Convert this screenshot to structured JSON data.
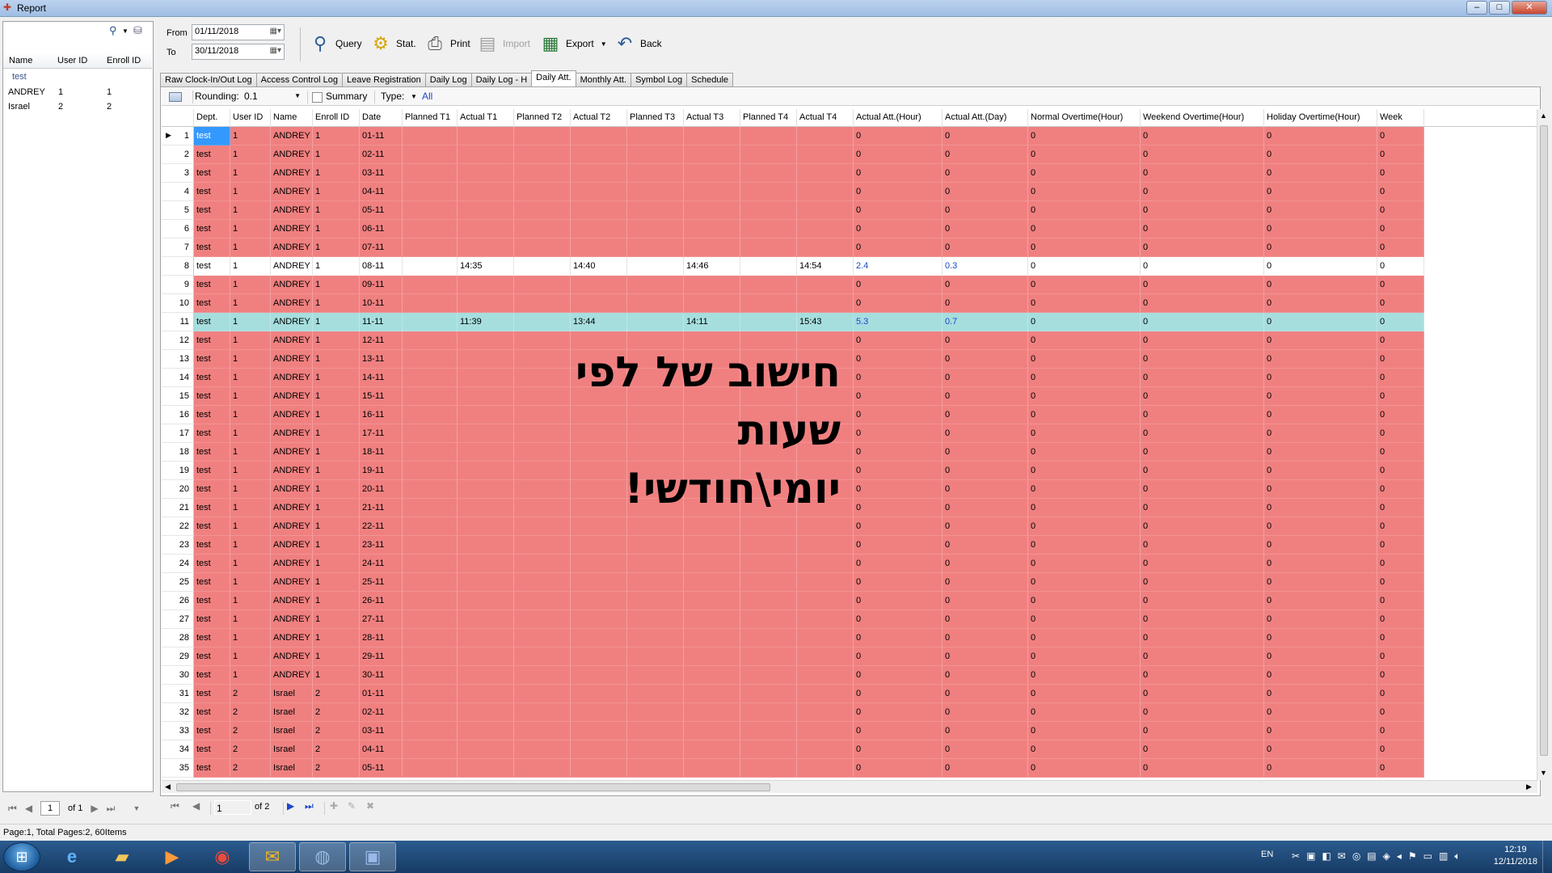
{
  "window": {
    "title": "Report",
    "min": "–",
    "max": "□",
    "close": "✕"
  },
  "left_panel": {
    "search_value": "",
    "columns": [
      "Name",
      "User ID",
      "Enroll ID"
    ],
    "group": "test",
    "rows": [
      [
        "ANDREY",
        "1",
        "1"
      ],
      [
        "Israel",
        "2",
        "2"
      ]
    ],
    "pager": {
      "page": "1",
      "of": "of 1"
    }
  },
  "toolbar": {
    "from_label": "From",
    "from_value": "01/11/2018",
    "to_label": "To",
    "to_value": "30/11/2018",
    "query": "Query",
    "stat": "Stat.",
    "print": "Print",
    "import": "Import",
    "export": "Export",
    "back": "Back"
  },
  "tabs": [
    "Raw Clock-In/Out Log",
    "Access Control Log",
    "Leave Registration",
    "Daily Log",
    "Daily Log - H",
    "Daily Att.",
    "Monthly Att.",
    "Symbol Log",
    "Schedule"
  ],
  "active_tab": "Daily Att.",
  "sub_toolbar": {
    "rounding_label": "Rounding:",
    "rounding_value": "0.1",
    "summary_label": "Summary",
    "type_label": "Type:",
    "type_value": "All"
  },
  "grid": {
    "columns": [
      "Dept.",
      "User ID",
      "Name",
      "Enroll ID",
      "Date",
      "Planned T1",
      "Actual T1",
      "Planned T2",
      "Actual T2",
      "Planned T3",
      "Actual T3",
      "Planned T4",
      "Actual T4",
      "Actual Att.(Hour)",
      "Actual Att.(Day)",
      "Normal Overtime(Hour)",
      "Weekend Overtime(Hour)",
      "Holiday Overtime(Hour)",
      "Week"
    ],
    "rows": [
      [
        "1",
        "test",
        "1",
        "ANDREY",
        "1",
        "01-11",
        "",
        "",
        "",
        "",
        "",
        "",
        "",
        "",
        "0",
        "0",
        "0",
        "0",
        "0",
        "0"
      ],
      [
        "2",
        "test",
        "1",
        "ANDREY",
        "1",
        "02-11",
        "",
        "",
        "",
        "",
        "",
        "",
        "",
        "",
        "0",
        "0",
        "0",
        "0",
        "0",
        "0"
      ],
      [
        "3",
        "test",
        "1",
        "ANDREY",
        "1",
        "03-11",
        "",
        "",
        "",
        "",
        "",
        "",
        "",
        "",
        "0",
        "0",
        "0",
        "0",
        "0",
        "0"
      ],
      [
        "4",
        "test",
        "1",
        "ANDREY",
        "1",
        "04-11",
        "",
        "",
        "",
        "",
        "",
        "",
        "",
        "",
        "0",
        "0",
        "0",
        "0",
        "0",
        "0"
      ],
      [
        "5",
        "test",
        "1",
        "ANDREY",
        "1",
        "05-11",
        "",
        "",
        "",
        "",
        "",
        "",
        "",
        "",
        "0",
        "0",
        "0",
        "0",
        "0",
        "0"
      ],
      [
        "6",
        "test",
        "1",
        "ANDREY",
        "1",
        "06-11",
        "",
        "",
        "",
        "",
        "",
        "",
        "",
        "",
        "0",
        "0",
        "0",
        "0",
        "0",
        "0"
      ],
      [
        "7",
        "test",
        "1",
        "ANDREY",
        "1",
        "07-11",
        "",
        "",
        "",
        "",
        "",
        "",
        "",
        "",
        "0",
        "0",
        "0",
        "0",
        "0",
        "0"
      ],
      [
        "8",
        "test",
        "1",
        "ANDREY",
        "1",
        "08-11",
        "",
        "14:35",
        "",
        "14:40",
        "",
        "14:46",
        "",
        "14:54",
        "2.4",
        "0.3",
        "0",
        "0",
        "0",
        "0"
      ],
      [
        "9",
        "test",
        "1",
        "ANDREY",
        "1",
        "09-11",
        "",
        "",
        "",
        "",
        "",
        "",
        "",
        "",
        "0",
        "0",
        "0",
        "0",
        "0",
        "0"
      ],
      [
        "10",
        "test",
        "1",
        "ANDREY",
        "1",
        "10-11",
        "",
        "",
        "",
        "",
        "",
        "",
        "",
        "",
        "0",
        "0",
        "0",
        "0",
        "0",
        "0"
      ],
      [
        "11",
        "test",
        "1",
        "ANDREY",
        "1",
        "11-11",
        "",
        "11:39",
        "",
        "13:44",
        "",
        "14:11",
        "",
        "15:43",
        "5.3",
        "0.7",
        "0",
        "0",
        "0",
        "0"
      ],
      [
        "12",
        "test",
        "1",
        "ANDREY",
        "1",
        "12-11",
        "",
        "",
        "",
        "",
        "",
        "",
        "",
        "",
        "0",
        "0",
        "0",
        "0",
        "0",
        "0"
      ],
      [
        "13",
        "test",
        "1",
        "ANDREY",
        "1",
        "13-11",
        "",
        "",
        "",
        "",
        "",
        "",
        "",
        "",
        "0",
        "0",
        "0",
        "0",
        "0",
        "0"
      ],
      [
        "14",
        "test",
        "1",
        "ANDREY",
        "1",
        "14-11",
        "",
        "",
        "",
        "",
        "",
        "",
        "",
        "",
        "0",
        "0",
        "0",
        "0",
        "0",
        "0"
      ],
      [
        "15",
        "test",
        "1",
        "ANDREY",
        "1",
        "15-11",
        "",
        "",
        "",
        "",
        "",
        "",
        "",
        "",
        "0",
        "0",
        "0",
        "0",
        "0",
        "0"
      ],
      [
        "16",
        "test",
        "1",
        "ANDREY",
        "1",
        "16-11",
        "",
        "",
        "",
        "",
        "",
        "",
        "",
        "",
        "0",
        "0",
        "0",
        "0",
        "0",
        "0"
      ],
      [
        "17",
        "test",
        "1",
        "ANDREY",
        "1",
        "17-11",
        "",
        "",
        "",
        "",
        "",
        "",
        "",
        "",
        "0",
        "0",
        "0",
        "0",
        "0",
        "0"
      ],
      [
        "18",
        "test",
        "1",
        "ANDREY",
        "1",
        "18-11",
        "",
        "",
        "",
        "",
        "",
        "",
        "",
        "",
        "0",
        "0",
        "0",
        "0",
        "0",
        "0"
      ],
      [
        "19",
        "test",
        "1",
        "ANDREY",
        "1",
        "19-11",
        "",
        "",
        "",
        "",
        "",
        "",
        "",
        "",
        "0",
        "0",
        "0",
        "0",
        "0",
        "0"
      ],
      [
        "20",
        "test",
        "1",
        "ANDREY",
        "1",
        "20-11",
        "",
        "",
        "",
        "",
        "",
        "",
        "",
        "",
        "0",
        "0",
        "0",
        "0",
        "0",
        "0"
      ],
      [
        "21",
        "test",
        "1",
        "ANDREY",
        "1",
        "21-11",
        "",
        "",
        "",
        "",
        "",
        "",
        "",
        "",
        "0",
        "0",
        "0",
        "0",
        "0",
        "0"
      ],
      [
        "22",
        "test",
        "1",
        "ANDREY",
        "1",
        "22-11",
        "",
        "",
        "",
        "",
        "",
        "",
        "",
        "",
        "0",
        "0",
        "0",
        "0",
        "0",
        "0"
      ],
      [
        "23",
        "test",
        "1",
        "ANDREY",
        "1",
        "23-11",
        "",
        "",
        "",
        "",
        "",
        "",
        "",
        "",
        "0",
        "0",
        "0",
        "0",
        "0",
        "0"
      ],
      [
        "24",
        "test",
        "1",
        "ANDREY",
        "1",
        "24-11",
        "",
        "",
        "",
        "",
        "",
        "",
        "",
        "",
        "0",
        "0",
        "0",
        "0",
        "0",
        "0"
      ],
      [
        "25",
        "test",
        "1",
        "ANDREY",
        "1",
        "25-11",
        "",
        "",
        "",
        "",
        "",
        "",
        "",
        "",
        "0",
        "0",
        "0",
        "0",
        "0",
        "0"
      ],
      [
        "26",
        "test",
        "1",
        "ANDREY",
        "1",
        "26-11",
        "",
        "",
        "",
        "",
        "",
        "",
        "",
        "",
        "0",
        "0",
        "0",
        "0",
        "0",
        "0"
      ],
      [
        "27",
        "test",
        "1",
        "ANDREY",
        "1",
        "27-11",
        "",
        "",
        "",
        "",
        "",
        "",
        "",
        "",
        "0",
        "0",
        "0",
        "0",
        "0",
        "0"
      ],
      [
        "28",
        "test",
        "1",
        "ANDREY",
        "1",
        "28-11",
        "",
        "",
        "",
        "",
        "",
        "",
        "",
        "",
        "0",
        "0",
        "0",
        "0",
        "0",
        "0"
      ],
      [
        "29",
        "test",
        "1",
        "ANDREY",
        "1",
        "29-11",
        "",
        "",
        "",
        "",
        "",
        "",
        "",
        "",
        "0",
        "0",
        "0",
        "0",
        "0",
        "0"
      ],
      [
        "30",
        "test",
        "1",
        "ANDREY",
        "1",
        "30-11",
        "",
        "",
        "",
        "",
        "",
        "",
        "",
        "",
        "0",
        "0",
        "0",
        "0",
        "0",
        "0"
      ],
      [
        "31",
        "test",
        "2",
        "Israel",
        "2",
        "01-11",
        "",
        "",
        "",
        "",
        "",
        "",
        "",
        "",
        "0",
        "0",
        "0",
        "0",
        "0",
        "0"
      ],
      [
        "32",
        "test",
        "2",
        "Israel",
        "2",
        "02-11",
        "",
        "",
        "",
        "",
        "",
        "",
        "",
        "",
        "0",
        "0",
        "0",
        "0",
        "0",
        "0"
      ],
      [
        "33",
        "test",
        "2",
        "Israel",
        "2",
        "03-11",
        "",
        "",
        "",
        "",
        "",
        "",
        "",
        "",
        "0",
        "0",
        "0",
        "0",
        "0",
        "0"
      ],
      [
        "34",
        "test",
        "2",
        "Israel",
        "2",
        "04-11",
        "",
        "",
        "",
        "",
        "",
        "",
        "",
        "",
        "0",
        "0",
        "0",
        "0",
        "0",
        "0"
      ],
      [
        "35",
        "test",
        "2",
        "Israel",
        "2",
        "05-11",
        "",
        "",
        "",
        "",
        "",
        "",
        "",
        "",
        "0",
        "0",
        "0",
        "0",
        "0",
        "0"
      ]
    ],
    "white_rows": [
      8
    ],
    "selected_rows": [
      11
    ],
    "row_color": "#f08080",
    "selected_color": "#a6dede",
    "first_cell_color": "#3399ff"
  },
  "main_pager": {
    "page": "1",
    "of": "of 2"
  },
  "overlay_lines": [
    "חישוב של לפי",
    "שעות",
    "יומי\\חודשי!"
  ],
  "status": "Page:1, Total Pages:2, 60Items",
  "taskbar": {
    "apps": [
      "ie-icon",
      "folder-icon",
      "media-player-icon",
      "chrome-icon",
      "outlook-icon",
      "network-app-icon",
      "report-app-icon"
    ],
    "lang": "EN",
    "time": "12:19",
    "date": "12/11/2018"
  }
}
